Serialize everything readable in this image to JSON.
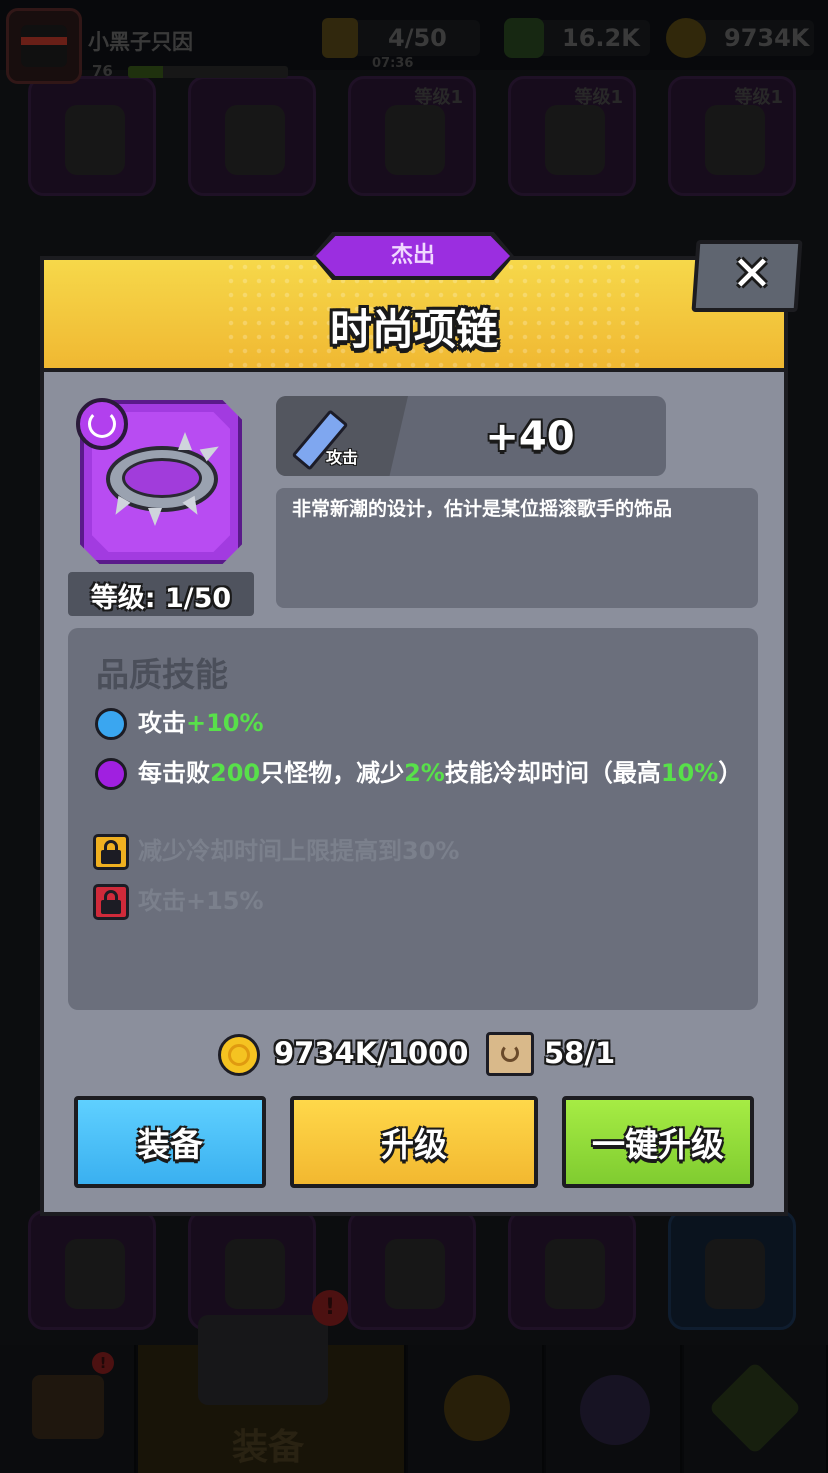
{
  "player": {
    "name": "小黑子只因",
    "level": "76",
    "xp_progress": 0.22
  },
  "resources": {
    "energy": "4/50",
    "energy_timer": "07:36",
    "gems": "16.2K",
    "coins": "9734K"
  },
  "background": {
    "card_level_label": "等级1"
  },
  "dialog": {
    "rarity": "杰出",
    "close_label": "✕",
    "item_name": "时尚项链",
    "item_level": "等级: 1/50",
    "stat": {
      "label": "攻击",
      "value": "+40"
    },
    "description": "非常新潮的设计，估计是某位摇滚歌手的饰品",
    "skills_title": "品质技能",
    "skills": [
      {
        "parts": [
          "攻击",
          "+10%"
        ],
        "state": "unlocked",
        "bullet_color": "#3aa6f0"
      },
      {
        "parts": [
          "每击败",
          "200",
          "只怪物，减少",
          "2%",
          "技能冷却时间（最高",
          "10%",
          "）"
        ],
        "state": "unlocked",
        "bullet_color": "#a020e0"
      },
      {
        "text": "减少冷却时间上限提高到30%",
        "state": "locked",
        "lock_color": "#f0b020"
      },
      {
        "text": "攻击+15%",
        "state": "locked",
        "lock_color": "#d02a3a"
      }
    ],
    "cost_coins": "9734K/1000",
    "cost_scrolls": "58/1",
    "buttons": {
      "equip": "装备",
      "upgrade": "升级",
      "upgrade_all": "一键升级"
    },
    "colors": {
      "header": "#f0c038",
      "rarity": "#9b2ee0",
      "equip": "#3ab0f0",
      "upgrade": "#f2b830",
      "upgrade_all": "#80cc30",
      "highlight": "#58e04a"
    }
  },
  "bottom_nav": {
    "active_label": "装备",
    "badge": "!"
  }
}
